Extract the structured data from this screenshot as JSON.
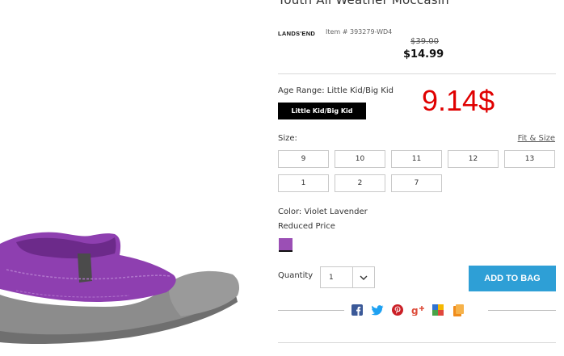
{
  "product": {
    "title": "Youth All Weather Moccasin",
    "brand": "LANDS'END",
    "item_number": "Item # 393279-WD4",
    "price_original": "$39.00",
    "price_sale": "$14.99"
  },
  "annotation": "9.14$",
  "age_range": {
    "label": "Age Range: Little Kid/Big Kid",
    "selected_option": "Little Kid/Big Kid"
  },
  "size": {
    "label": "Size:",
    "fit_link": "Fit & Size",
    "options": [
      "9",
      "10",
      "11",
      "12",
      "13",
      "1",
      "2",
      "7"
    ]
  },
  "color": {
    "label": "Color: Violet Lavender",
    "note": "Reduced Price",
    "swatch_color": "#9b4fb5"
  },
  "quantity": {
    "label": "Quantity",
    "value": "1"
  },
  "actions": {
    "add_to_bag": "ADD TO BAG"
  },
  "share_icons": [
    "facebook-icon",
    "twitter-icon",
    "pinterest-icon",
    "google-plus-icon",
    "delicious-icon",
    "bookmark-icon"
  ],
  "colors": {
    "accent": "#2e9fd6",
    "annotation": "#e00000",
    "shoe_purple": "#8e3fb0"
  }
}
